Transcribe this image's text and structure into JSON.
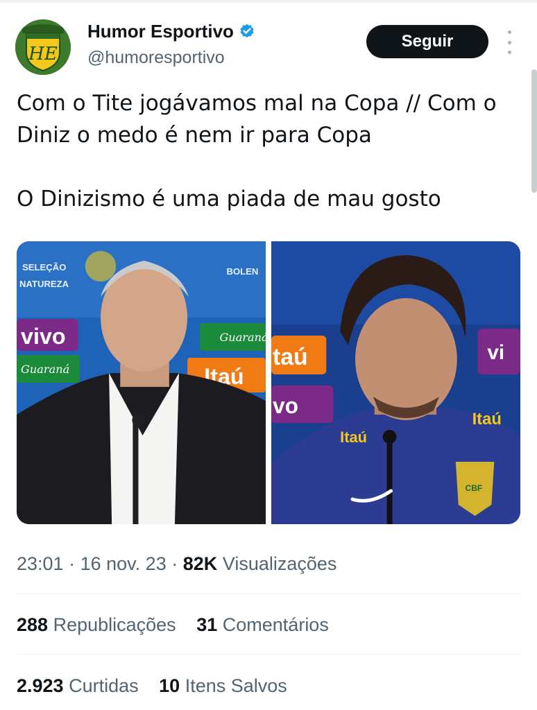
{
  "author": {
    "name": "Humor Esportivo",
    "handle": "@humoresportivo",
    "verified": true,
    "avatar_icon": "humor-esportivo-shield-logo"
  },
  "follow_label": "Seguir",
  "tweet": {
    "line1": "Com o Tite jogávamos mal na Copa // Com o Diniz o medo é nem ir para Copa",
    "line2": "O Dinizismo é uma piada de mau gosto"
  },
  "media": [
    {
      "alt": "Tite em coletiva da seleção brasileira",
      "banner_texts": [
        "SELEÇÃO",
        "NATUREZA",
        "BOLEN",
        "vivo",
        "Guaraná",
        "Itaú"
      ]
    },
    {
      "alt": "Diniz em coletiva da seleção brasileira",
      "banner_texts": [
        "taú",
        "vi",
        "vo",
        "Itaú",
        "CBF"
      ]
    }
  ],
  "meta": {
    "time": "23:01",
    "date": "16 nov. 23",
    "separator": "·",
    "views_count": "82K",
    "views_label": "Visualizações"
  },
  "stats": {
    "reposts_count": "288",
    "reposts_label": "Republicações",
    "comments_count": "31",
    "comments_label": "Comentários",
    "likes_count": "2.923",
    "likes_label": "Curtidas",
    "saves_count": "10",
    "saves_label": "Itens Salvos"
  },
  "colors": {
    "text_primary": "#0f1419",
    "text_secondary": "#536471",
    "verified_blue": "#1d9bf0",
    "follow_bg": "#0f1419",
    "divider": "#eff3f4"
  }
}
